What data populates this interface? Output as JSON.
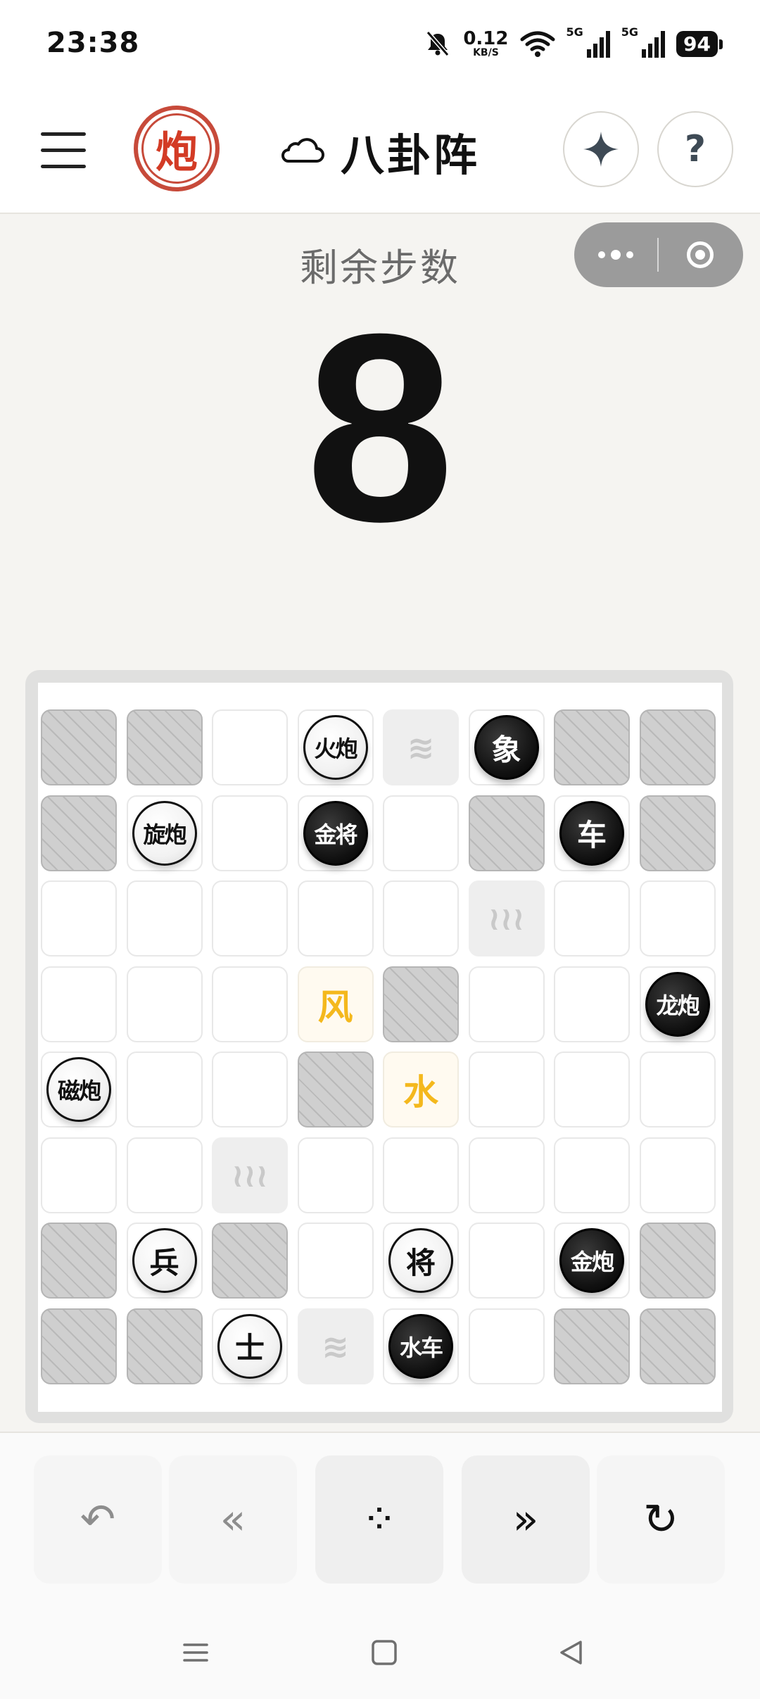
{
  "status_bar": {
    "time": "23:38",
    "net_speed": "0.12",
    "net_speed_unit": "KB/S",
    "sim1": "5G",
    "sim2": "5G",
    "battery": "94"
  },
  "header": {
    "logo_glyph": "炮",
    "title": "八卦阵",
    "title_icon": "cloud-icon",
    "sparkle_icon": "sparkle-icon",
    "help_label": "?"
  },
  "capsule": {
    "more_icon": "more-dots-icon",
    "close_icon": "target-icon"
  },
  "steps": {
    "label": "剩余步数",
    "value": "8"
  },
  "board": {
    "rows": 8,
    "cols": 8,
    "cells": [
      [
        "blocked",
        "blocked",
        "empty",
        "empty",
        "ground",
        "empty",
        "blocked",
        "blocked"
      ],
      [
        "blocked",
        "empty",
        "empty",
        "empty",
        "empty",
        "blocked",
        "empty",
        "blocked"
      ],
      [
        "empty",
        "empty",
        "empty",
        "empty",
        "empty",
        "ground",
        "empty",
        "empty"
      ],
      [
        "empty",
        "empty",
        "empty",
        "elem",
        "blocked",
        "empty",
        "empty",
        "empty"
      ],
      [
        "empty",
        "empty",
        "empty",
        "blocked",
        "elem",
        "empty",
        "empty",
        "empty"
      ],
      [
        "empty",
        "empty",
        "ground",
        "empty",
        "empty",
        "empty",
        "empty",
        "empty"
      ],
      [
        "blocked",
        "empty",
        "blocked",
        "empty",
        "empty",
        "empty",
        "empty",
        "blocked"
      ],
      [
        "blocked",
        "blocked",
        "empty",
        "ground",
        "empty",
        "empty",
        "blocked",
        "blocked"
      ]
    ],
    "terrain_symbols": [
      {
        "row": 0,
        "col": 4,
        "symbol": "≋"
      },
      {
        "row": 2,
        "col": 5,
        "symbol": "≀≀≀"
      },
      {
        "row": 5,
        "col": 2,
        "symbol": "≀≀≀"
      },
      {
        "row": 7,
        "col": 3,
        "symbol": "≋"
      }
    ],
    "elements": [
      {
        "row": 3,
        "col": 3,
        "text": "风",
        "color": "#f4b81d"
      },
      {
        "row": 4,
        "col": 4,
        "text": "水",
        "color": "#f4b81d"
      }
    ],
    "pieces": [
      {
        "row": 0,
        "col": 3,
        "side": "white",
        "text": "火炮"
      },
      {
        "row": 0,
        "col": 5,
        "side": "black",
        "text": "象"
      },
      {
        "row": 1,
        "col": 1,
        "side": "white",
        "text": "旋炮"
      },
      {
        "row": 1,
        "col": 3,
        "side": "black",
        "text": "金将"
      },
      {
        "row": 1,
        "col": 6,
        "side": "black",
        "text": "车"
      },
      {
        "row": 3,
        "col": 7,
        "side": "black",
        "text": "龙炮"
      },
      {
        "row": 4,
        "col": 0,
        "side": "white",
        "text": "磁炮"
      },
      {
        "row": 6,
        "col": 1,
        "side": "white",
        "text": "兵"
      },
      {
        "row": 6,
        "col": 4,
        "side": "white",
        "text": "将"
      },
      {
        "row": 6,
        "col": 6,
        "side": "black",
        "text": "金炮"
      },
      {
        "row": 7,
        "col": 2,
        "side": "white",
        "text": "士"
      },
      {
        "row": 7,
        "col": 4,
        "side": "black",
        "text": "水车"
      }
    ]
  },
  "controls": [
    {
      "name": "undo-button",
      "icon": "undo-icon",
      "glyph": "↶",
      "enabled": false
    },
    {
      "name": "prev-button",
      "icon": "double-left-icon",
      "glyph": "«",
      "enabled": false
    },
    {
      "name": "menu-grid-button",
      "icon": "four-dots-icon",
      "glyph": "⁘",
      "enabled": true
    },
    {
      "name": "next-button",
      "icon": "double-right-icon",
      "glyph": "»",
      "enabled": true
    },
    {
      "name": "restart-button",
      "icon": "restart-icon",
      "glyph": "↻",
      "enabled": true
    }
  ],
  "nav_bar": {
    "menu_icon": "nav-menu-icon",
    "home_icon": "nav-home-icon",
    "back_icon": "nav-back-icon"
  }
}
